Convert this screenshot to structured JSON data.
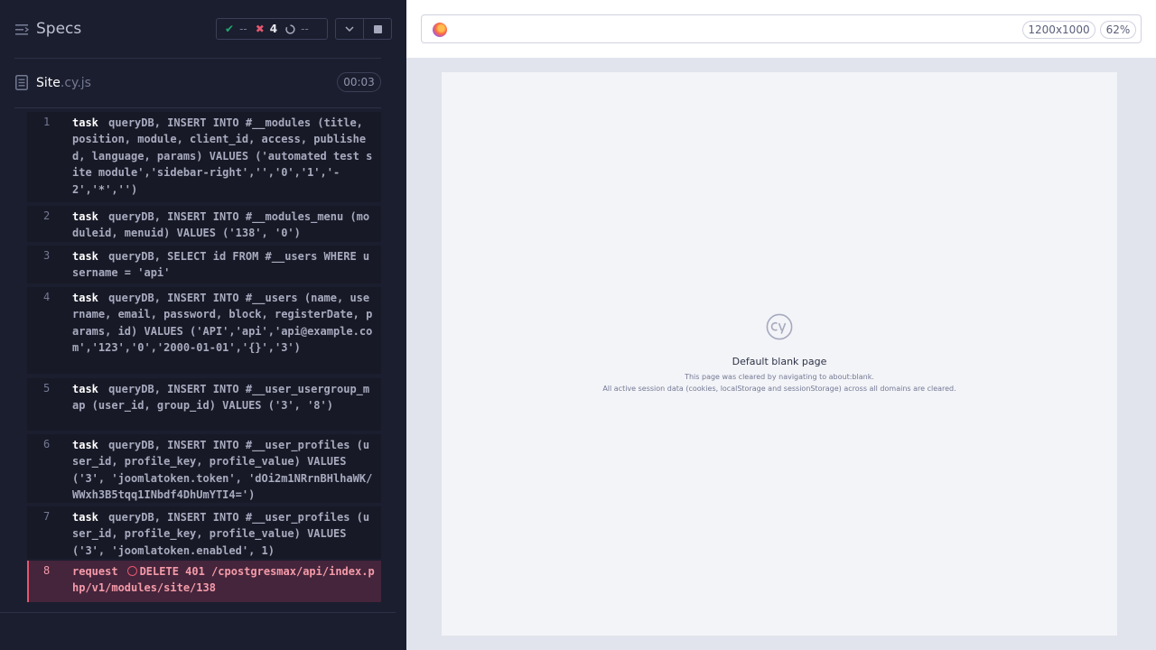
{
  "reporter": {
    "header": {
      "title": "Specs",
      "stats": {
        "passed": "--",
        "failed": "4",
        "pending": "--"
      }
    },
    "spec": {
      "name": "Site",
      "ext": ".cy.js",
      "duration": "00:03"
    },
    "commands": [
      {
        "num": "1",
        "name": "task",
        "message": "queryDB, INSERT INTO #__modules (title, position, module, client_id, access, published, language, params) VALUES ('automated test site module','sidebar-right','','0','1','-2','*','')"
      },
      {
        "num": "2",
        "name": "task",
        "message": "queryDB, INSERT INTO #__modules_menu (moduleid, menuid) VALUES ('138', '0')"
      },
      {
        "num": "3",
        "name": "task",
        "message": "queryDB, SELECT id FROM #__users WHERE username = 'api'"
      },
      {
        "num": "4",
        "name": "task",
        "message": "queryDB, INSERT INTO #__users (name, username, email, password, block, registerDate, params, id) VALUES ('API','api','api@example.com','123','0','2000-01-01','{}','3')"
      },
      {
        "num": "5",
        "name": "task",
        "message": "queryDB, INSERT INTO #__user_usergroup_map (user_id, group_id) VALUES ('3', '8')"
      },
      {
        "num": "6",
        "name": "task",
        "message": "queryDB, INSERT INTO #__user_profiles (user_id, profile_key, profile_value) VALUES ('3', 'joomlatoken.token', 'dOi2m1NRrnBHlhaWK/WWxh3B5tqq1INbdf4DhUmYTI4=')"
      },
      {
        "num": "7",
        "name": "task",
        "message": "queryDB, INSERT INTO #__user_profiles (user_id, profile_key, profile_value) VALUES ('3', 'joomlatoken.enabled', 1)"
      },
      {
        "num": "8",
        "name": "request",
        "message": "DELETE 401 /cpostgresmax/api/index.php/v1/modules/site/138",
        "status": "error"
      }
    ]
  },
  "aut": {
    "viewport": "1200x1000",
    "zoom": "62%",
    "blank_page": {
      "title": "Default blank page",
      "line1": "This page was cleared by navigating to about:blank.",
      "line2": "All active session data (cookies, localStorage and sessionStorage) across all domains are cleared."
    }
  },
  "colors": {
    "pass": "#1fa971",
    "fail": "#e45770",
    "error_bg": "#44253b"
  }
}
